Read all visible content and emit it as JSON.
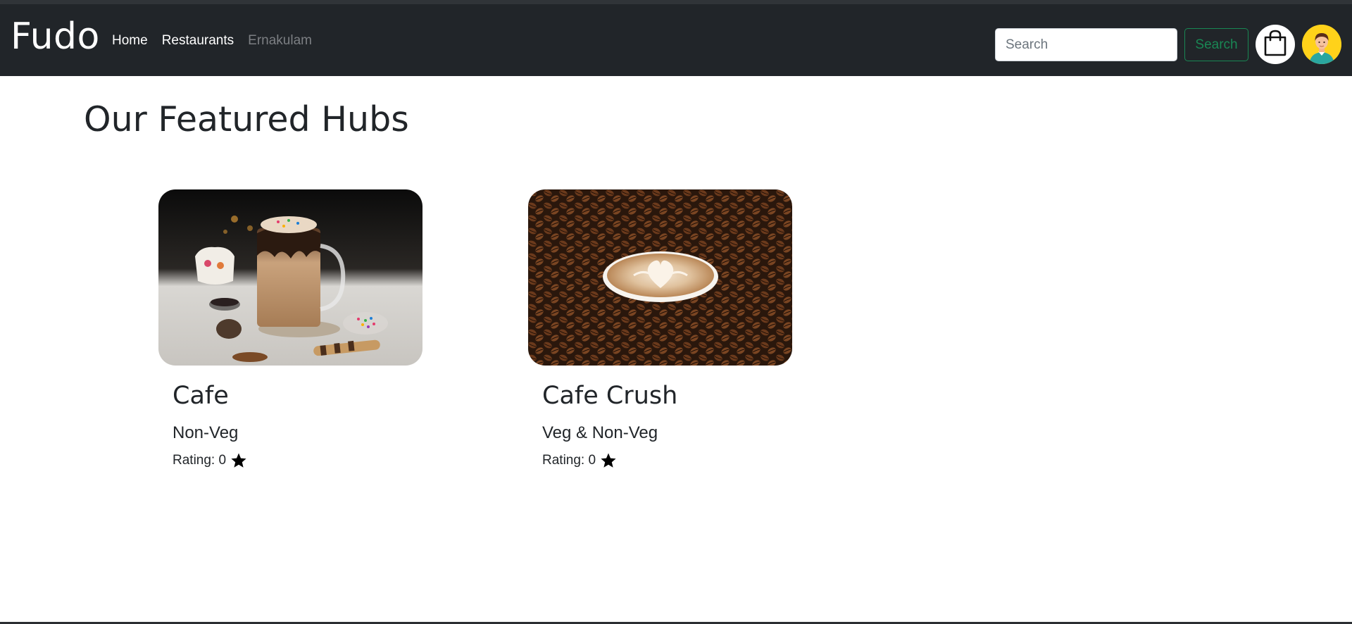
{
  "navbar": {
    "brand": "Fudo",
    "links": [
      {
        "label": "Home"
      },
      {
        "label": "Restaurants"
      },
      {
        "label": "Ernakulam"
      }
    ],
    "search": {
      "placeholder": "Search",
      "value": ""
    },
    "search_button_label": "Search",
    "cart_icon": "shopping-bag-icon",
    "avatar_icon": "user-avatar-icon"
  },
  "main": {
    "title": "Our Featured Hubs",
    "hubs": [
      {
        "name": "Cafe",
        "category": "Non-Veg",
        "rating_label": "Rating: 0",
        "rating": 0,
        "image": "milkshake-photo"
      },
      {
        "name": "Cafe Crush",
        "category": "Veg & Non-Veg",
        "rating_label": "Rating: 0",
        "rating": 0,
        "image": "latte-coffee-beans-photo"
      }
    ]
  },
  "colors": {
    "navbar_bg": "#212529",
    "accent_green": "#198754",
    "avatar_bg": "#ffd21a"
  }
}
